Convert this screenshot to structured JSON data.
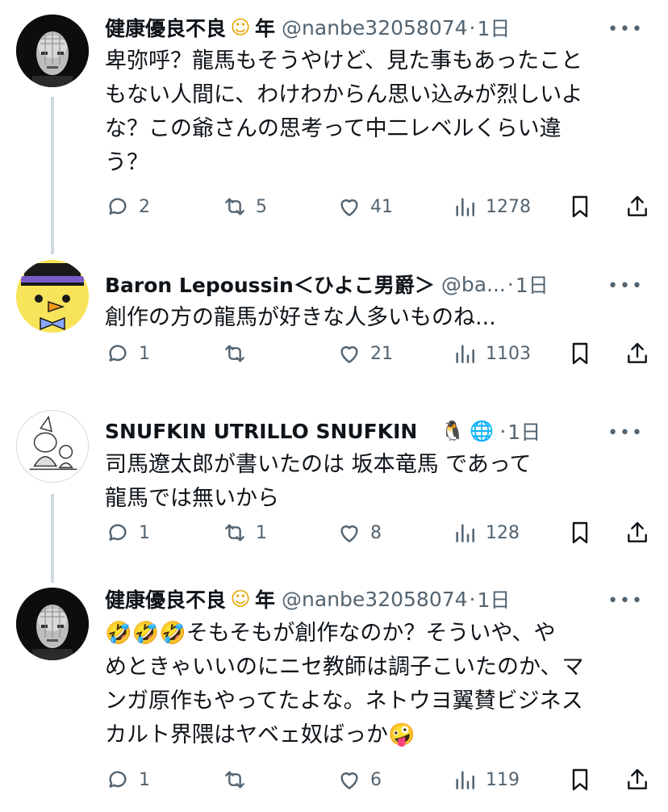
{
  "colors": {
    "text": "#0f1419",
    "secondary": "#536471",
    "thread_line": "#cfd9de"
  },
  "posts": [
    {
      "name": "健康優良不良",
      "name_emoji": "☺",
      "name_suffix": "年",
      "handle": "@nanbe32058074",
      "sep": "·",
      "time": "1日",
      "more": "•••",
      "lines": [
        "卑弥呼？龍馬もそうやけど、見た事もあったこと",
        "もない人間に、わけわからん思い込みが烈しいよ",
        "な？この爺さんの思考って中二レベルくらい違",
        "う？"
      ],
      "replies": "2",
      "reposts": "5",
      "likes": "41",
      "views": "1278"
    },
    {
      "name": "Baron Lepoussin＜ひよこ男爵＞",
      "handle": "@ba...",
      "sep": "·",
      "time": "1日",
      "more": "•••",
      "lines": [
        "創作の方の龍馬が好きな人多いものね..."
      ],
      "replies": "1",
      "reposts": "",
      "likes": "21",
      "views": "1103"
    },
    {
      "name": "SNUFKIN UTRILLO SNUFKIN",
      "badge1": "🐧",
      "badge2": "🌐",
      "sep": "·",
      "time": "1日",
      "more": "•••",
      "lines": [
        "司馬遼太郎が書いたのは 坂本竜馬 であって",
        "龍馬では無いから"
      ],
      "replies": "1",
      "reposts": "1",
      "likes": "8",
      "views": "128"
    },
    {
      "name": "健康優良不良",
      "name_emoji": "☺",
      "name_suffix": "年",
      "handle": "@nanbe32058074",
      "sep": "·",
      "time": "1日",
      "more": "•••",
      "line1_emoji": "🤣🤣🤣",
      "lines": [
        "そもそもが創作なのか？そういや、や",
        "めときゃいいのにニセ教師は調子こいたのか、マ",
        "ンガ原作もやってたよな。ネトウヨ翼賛ビジネス",
        "カルト界隈はヤベェ奴ばっか"
      ],
      "tail_emoji": "🤪",
      "replies": "1",
      "reposts": "",
      "likes": "6",
      "views": "119"
    }
  ]
}
